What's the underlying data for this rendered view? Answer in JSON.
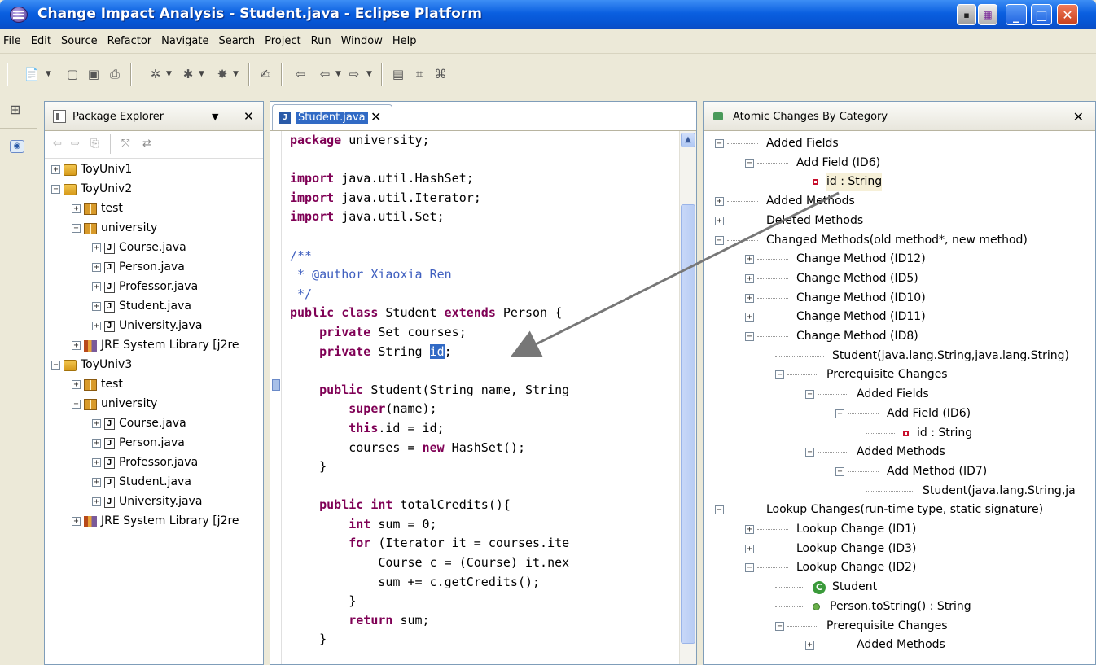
{
  "window": {
    "title": "Change Impact Analysis - Student.java - Eclipse Platform"
  },
  "menu": [
    "File",
    "Edit",
    "Source",
    "Refactor",
    "Navigate",
    "Search",
    "Project",
    "Run",
    "Window",
    "Help"
  ],
  "package_explorer": {
    "title": "Package Explorer",
    "items": [
      {
        "label": "ToyUniv1",
        "kind": "project",
        "indent": 0,
        "exp": "+"
      },
      {
        "label": "ToyUniv2",
        "kind": "project",
        "indent": 0,
        "exp": "-"
      },
      {
        "label": "test",
        "kind": "package",
        "indent": 1,
        "exp": "+"
      },
      {
        "label": "university",
        "kind": "package",
        "indent": 1,
        "exp": "-"
      },
      {
        "label": "Course.java",
        "kind": "java",
        "indent": 2,
        "exp": "+"
      },
      {
        "label": "Person.java",
        "kind": "java",
        "indent": 2,
        "exp": "+"
      },
      {
        "label": "Professor.java",
        "kind": "java",
        "indent": 2,
        "exp": "+"
      },
      {
        "label": "Student.java",
        "kind": "java",
        "indent": 2,
        "exp": "+"
      },
      {
        "label": "University.java",
        "kind": "java",
        "indent": 2,
        "exp": "+"
      },
      {
        "label": "JRE System Library [j2re",
        "kind": "lib",
        "indent": 1,
        "exp": "+"
      },
      {
        "label": "ToyUniv3",
        "kind": "project",
        "indent": 0,
        "exp": "-"
      },
      {
        "label": "test",
        "kind": "package",
        "indent": 1,
        "exp": "+"
      },
      {
        "label": "university",
        "kind": "package",
        "indent": 1,
        "exp": "-"
      },
      {
        "label": "Course.java",
        "kind": "java",
        "indent": 2,
        "exp": "+"
      },
      {
        "label": "Person.java",
        "kind": "java",
        "indent": 2,
        "exp": "+"
      },
      {
        "label": "Professor.java",
        "kind": "java",
        "indent": 2,
        "exp": "+"
      },
      {
        "label": "Student.java",
        "kind": "java",
        "indent": 2,
        "exp": "+"
      },
      {
        "label": "University.java",
        "kind": "java",
        "indent": 2,
        "exp": "+"
      },
      {
        "label": "JRE System Library [j2re",
        "kind": "lib",
        "indent": 1,
        "exp": "+"
      }
    ]
  },
  "editor": {
    "tab_label": "Student.java",
    "lines": [
      [
        [
          "kw",
          "package"
        ],
        [
          "t",
          " university;"
        ]
      ],
      [],
      [
        [
          "kw",
          "import"
        ],
        [
          "t",
          " java.util.HashSet;"
        ]
      ],
      [
        [
          "kw",
          "import"
        ],
        [
          "t",
          " java.util.Iterator;"
        ]
      ],
      [
        [
          "kw",
          "import"
        ],
        [
          "t",
          " java.util.Set;"
        ]
      ],
      [],
      [
        [
          "cm",
          "/**"
        ]
      ],
      [
        [
          "cm",
          " * @author Xiaoxia Ren"
        ]
      ],
      [
        [
          "cm",
          " */"
        ]
      ],
      [
        [
          "kw",
          "public class"
        ],
        [
          "t",
          " Student "
        ],
        [
          "kw",
          "extends"
        ],
        [
          "t",
          " Person {"
        ]
      ],
      [
        [
          "t",
          "    "
        ],
        [
          "kw",
          "private"
        ],
        [
          "t",
          " Set courses;"
        ]
      ],
      [
        [
          "t",
          "    "
        ],
        [
          "kw",
          "private"
        ],
        [
          "t",
          " String "
        ],
        [
          "sel",
          "id"
        ],
        [
          "t",
          ";"
        ]
      ],
      [],
      [
        [
          "t",
          "    "
        ],
        [
          "kw",
          "public"
        ],
        [
          "t",
          " Student(String name, String"
        ]
      ],
      [
        [
          "t",
          "        "
        ],
        [
          "kw",
          "super"
        ],
        [
          "t",
          "(name);"
        ]
      ],
      [
        [
          "t",
          "        "
        ],
        [
          "kw",
          "this"
        ],
        [
          "t",
          ".id = id;"
        ]
      ],
      [
        [
          "t",
          "        courses = "
        ],
        [
          "kw",
          "new"
        ],
        [
          "t",
          " HashSet();"
        ]
      ],
      [
        [
          "t",
          "    }"
        ]
      ],
      [],
      [
        [
          "t",
          "    "
        ],
        [
          "kw",
          "public int"
        ],
        [
          "t",
          " totalCredits(){"
        ]
      ],
      [
        [
          "t",
          "        "
        ],
        [
          "kw",
          "int"
        ],
        [
          "t",
          " sum = 0;"
        ]
      ],
      [
        [
          "t",
          "        "
        ],
        [
          "kw",
          "for"
        ],
        [
          "t",
          " (Iterator it = courses.ite"
        ]
      ],
      [
        [
          "t",
          "            Course c = (Course) it.nex"
        ]
      ],
      [
        [
          "t",
          "            sum += c.getCredits();"
        ]
      ],
      [
        [
          "t",
          "        }"
        ]
      ],
      [
        [
          "t",
          "        "
        ],
        [
          "kw",
          "return"
        ],
        [
          "t",
          " sum;"
        ]
      ],
      [
        [
          "t",
          "    }"
        ]
      ]
    ]
  },
  "atomic_view": {
    "title": "Atomic Changes By Category",
    "items": [
      {
        "label": "Added Fields",
        "indent": 0,
        "exp": "-",
        "icon": "none"
      },
      {
        "label": "Add Field (ID6)",
        "indent": 1,
        "exp": "-",
        "icon": "none"
      },
      {
        "label": "id : String",
        "indent": 2,
        "exp": "",
        "icon": "field",
        "highlight": true
      },
      {
        "label": "Added Methods",
        "indent": 0,
        "exp": "+",
        "icon": "none"
      },
      {
        "label": "Deleted Methods",
        "indent": 0,
        "exp": "+",
        "icon": "none"
      },
      {
        "label": "Changed Methods(old method*, new method)",
        "indent": 0,
        "exp": "-",
        "icon": "none"
      },
      {
        "label": "Change Method (ID12)",
        "indent": 1,
        "exp": "+",
        "icon": "none"
      },
      {
        "label": "Change Method (ID5)",
        "indent": 1,
        "exp": "+",
        "icon": "none"
      },
      {
        "label": "Change Method (ID10)",
        "indent": 1,
        "exp": "+",
        "icon": "none"
      },
      {
        "label": "Change Method (ID11)",
        "indent": 1,
        "exp": "+",
        "icon": "none"
      },
      {
        "label": "Change Method (ID8)",
        "indent": 1,
        "exp": "-",
        "icon": "none"
      },
      {
        "label": "Student(java.lang.String,java.lang.String)",
        "indent": 2,
        "exp": "",
        "icon": "none"
      },
      {
        "label": "Prerequisite Changes",
        "indent": 2,
        "exp": "-",
        "icon": "none"
      },
      {
        "label": "Added Fields",
        "indent": 3,
        "exp": "-",
        "icon": "none"
      },
      {
        "label": "Add Field (ID6)",
        "indent": 4,
        "exp": "-",
        "icon": "none"
      },
      {
        "label": "id : String",
        "indent": 5,
        "exp": "",
        "icon": "field"
      },
      {
        "label": "Added Methods",
        "indent": 3,
        "exp": "-",
        "icon": "none"
      },
      {
        "label": "Add Method (ID7)",
        "indent": 4,
        "exp": "-",
        "icon": "none"
      },
      {
        "label": "Student(java.lang.String,ja",
        "indent": 5,
        "exp": "",
        "icon": "none"
      },
      {
        "label": "Lookup Changes(run-time type, static signature)",
        "indent": 0,
        "exp": "-",
        "icon": "none"
      },
      {
        "label": "Lookup Change (ID1)",
        "indent": 1,
        "exp": "+",
        "icon": "none"
      },
      {
        "label": "Lookup Change (ID3)",
        "indent": 1,
        "exp": "+",
        "icon": "none"
      },
      {
        "label": "Lookup Change (ID2)",
        "indent": 1,
        "exp": "-",
        "icon": "none"
      },
      {
        "label": "Student",
        "indent": 2,
        "exp": "",
        "icon": "class"
      },
      {
        "label": "Person.toString() : String",
        "indent": 2,
        "exp": "",
        "icon": "method"
      },
      {
        "label": "Prerequisite Changes",
        "indent": 2,
        "exp": "-",
        "icon": "none"
      },
      {
        "label": "Added Methods",
        "indent": 3,
        "exp": "+",
        "icon": "none"
      }
    ]
  }
}
